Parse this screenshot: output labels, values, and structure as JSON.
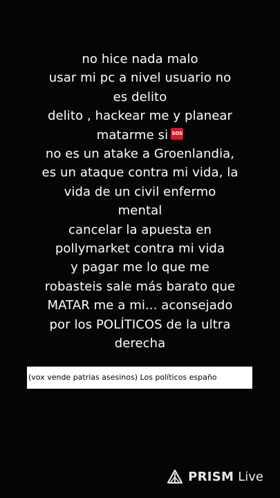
{
  "post": {
    "lines": [
      "no hice nada malo",
      "usar mi pc a nivel usuario no",
      "es delito",
      "delito , hackear me y planear",
      "matarme si",
      "no es un atake a Groenlandia,",
      "es un ataque contra mi vida, la",
      "vida de un civil enfermo",
      "mental",
      "cancelar la apuesta en",
      "pollymarket contra mi vida",
      "y pagar me lo que me",
      "robasteis sale más barato que",
      "MATAR me a mi... aconsejado",
      "por los POLÍTICOS de la ultra",
      "derecha"
    ],
    "emoji": {
      "icon": "sos-emoji-icon",
      "label": "SOS",
      "color": "#e0162b"
    }
  },
  "ticker": {
    "text": "(vox vende patrias asesinos)  Los políticos españo"
  },
  "watermark": {
    "icon": "prism-logo-icon",
    "brand": "PRISM",
    "suffix": "Live"
  },
  "colors": {
    "background": "#050505",
    "text": "#ffffff",
    "ticker_background": "#ffffff",
    "ticker_text": "#000000"
  }
}
